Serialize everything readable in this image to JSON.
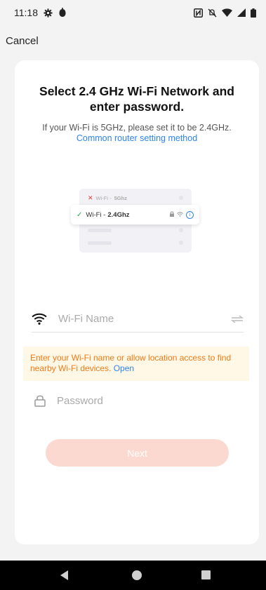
{
  "status_bar": {
    "time": "11:18",
    "icons": [
      "gear-icon",
      "notification-icon",
      "nfc-icon",
      "mute-icon",
      "wifi-signal-icon",
      "cell-signal-icon",
      "battery-icon"
    ]
  },
  "header": {
    "cancel_label": "Cancel"
  },
  "main": {
    "title": "Select 2.4 GHz Wi-Fi Network and enter password.",
    "subtitle": "If your Wi-Fi is 5GHz, please set it to be 2.4GHz.",
    "router_link": "Common router setting method",
    "illustration": {
      "row_5ghz_prefix": "Wi-Fi - ",
      "row_5ghz_band": "5Ghz",
      "row_24ghz_prefix": "Wi-Fi - ",
      "row_24ghz_band": "2.4Ghz"
    },
    "wifi_field": {
      "placeholder": "Wi-Fi Name",
      "value": ""
    },
    "notice": {
      "text": "Enter your Wi-Fi name or allow location access to find nearby Wi-Fi devices. ",
      "link": "Open"
    },
    "password_field": {
      "placeholder": "Password",
      "value": ""
    },
    "next_label": "Next"
  },
  "colors": {
    "accent_blue": "#2d84f0",
    "notice_text": "#f07a17",
    "notice_bg": "#fff8e6",
    "button_disabled": "#fcd9d0"
  }
}
